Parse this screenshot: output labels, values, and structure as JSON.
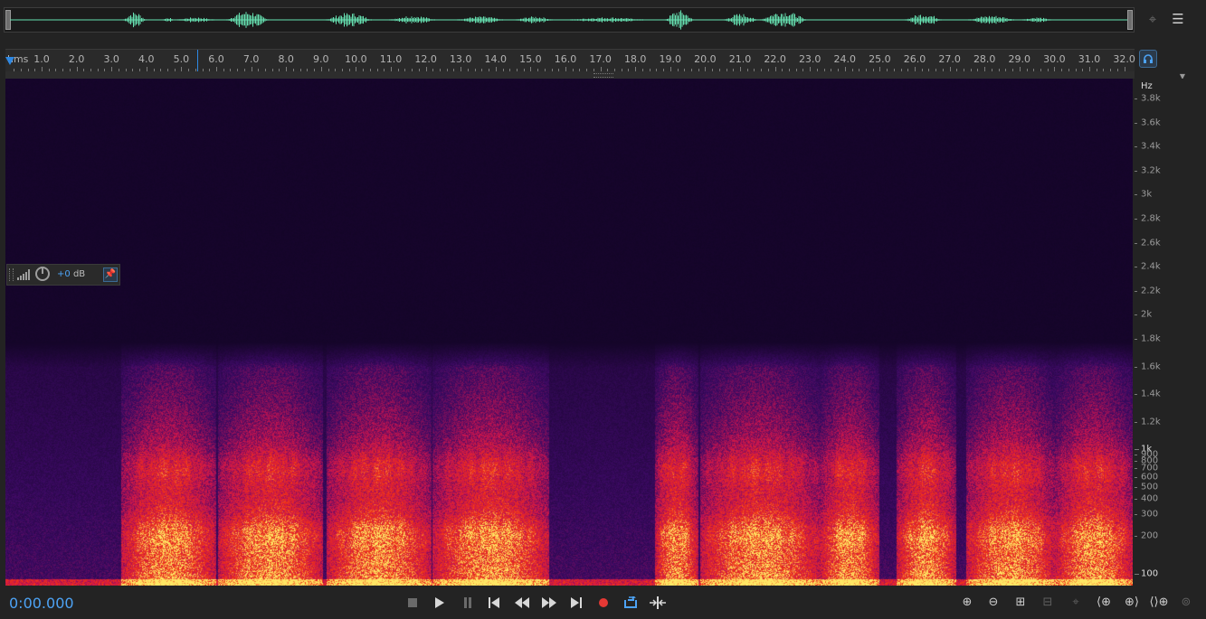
{
  "overview": {
    "waveform_color": "#66e0b0"
  },
  "toolbar_right": {
    "zoom_icon": "zoom-selection-icon",
    "menu_icon": "panel-menu-icon"
  },
  "ruler": {
    "unit": "hms",
    "ticks": [
      "1.0",
      "2.0",
      "3.0",
      "4.0",
      "5.0",
      "6.0",
      "7.0",
      "8.0",
      "9.0",
      "10.0",
      "11.0",
      "12.0",
      "13.0",
      "14.0",
      "15.0",
      "16.0",
      "17.0",
      "18.0",
      "19.0",
      "20.0",
      "21.0",
      "22.0",
      "23.0",
      "24.0",
      "25.0",
      "26.0",
      "27.0",
      "28.0",
      "29.0",
      "30.0",
      "31.0",
      "32.0"
    ]
  },
  "hud": {
    "volume_value": "+0",
    "volume_unit": "dB"
  },
  "frequency_axis": {
    "unit": "Hz",
    "labels": [
      {
        "text": "3.8k",
        "hz": 3800
      },
      {
        "text": "3.6k",
        "hz": 3600
      },
      {
        "text": "3.4k",
        "hz": 3400
      },
      {
        "text": "3.2k",
        "hz": 3200
      },
      {
        "text": "3k",
        "hz": 3000
      },
      {
        "text": "2.8k",
        "hz": 2800
      },
      {
        "text": "2.6k",
        "hz": 2600
      },
      {
        "text": "2.4k",
        "hz": 2400
      },
      {
        "text": "2.2k",
        "hz": 2200
      },
      {
        "text": "2k",
        "hz": 2000
      },
      {
        "text": "1.8k",
        "hz": 1800
      },
      {
        "text": "1.6k",
        "hz": 1600
      },
      {
        "text": "1.4k",
        "hz": 1400
      },
      {
        "text": "1.2k",
        "hz": 1200
      },
      {
        "text": "1k",
        "hz": 1000,
        "major": true
      },
      {
        "text": "900",
        "hz": 900
      },
      {
        "text": "800",
        "hz": 800
      },
      {
        "text": "700",
        "hz": 700
      },
      {
        "text": "600",
        "hz": 600
      },
      {
        "text": "500",
        "hz": 500
      },
      {
        "text": "400",
        "hz": 400
      },
      {
        "text": "300",
        "hz": 300
      },
      {
        "text": "200",
        "hz": 200
      },
      {
        "text": "100",
        "hz": 100,
        "major": true
      }
    ]
  },
  "transport": {
    "current_time": "0:00.000",
    "buttons": [
      "stop",
      "play",
      "pause",
      "go-to-start",
      "rewind",
      "fast-forward",
      "go-to-end",
      "record",
      "loop",
      "skip-selection"
    ]
  },
  "colors": {
    "accent": "#2e88e3",
    "record": "#e53935",
    "spectrum_low": "#2a0a4a",
    "spectrum_mid": "#d61f1f",
    "spectrum_high": "#ffe36a"
  }
}
